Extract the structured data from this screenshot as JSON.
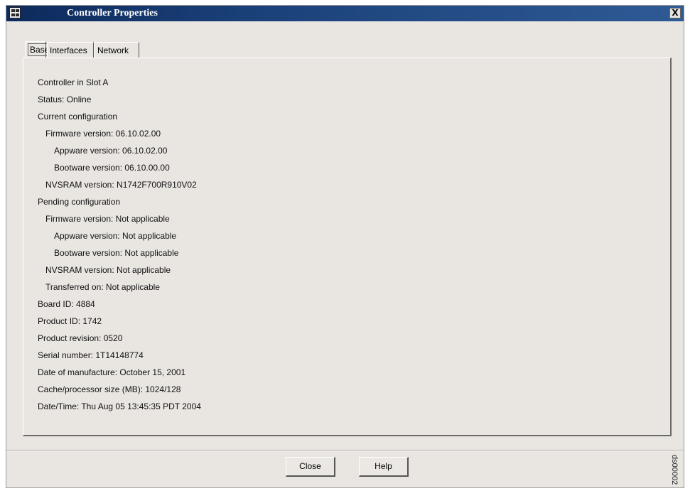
{
  "window": {
    "title": "Controller Properties",
    "close_glyph": "X"
  },
  "tabs": [
    {
      "label": "Base",
      "active": true
    },
    {
      "label": "Interfaces",
      "active": false
    },
    {
      "label": "Network",
      "active": false
    }
  ],
  "properties": [
    "Controller in Slot A",
    "Status: Online",
    "Current configuration",
    "Firmware version: 06.10.02.00",
    "Appware version: 06.10.02.00",
    "Bootware version: 06.10.00.00",
    "NVSRAM version: N1742F700R910V02",
    "Pending configuration",
    "Firmware version: Not applicable",
    "Appware version: Not applicable",
    "Bootware version: Not applicable",
    "NVSRAM version: Not applicable",
    "Transferred on: Not applicable",
    "Board ID: 4884",
    "Product ID: 1742",
    "Product revision: 0520",
    "Serial number: 1T14148774",
    "Date of manufacture: October 15, 2001",
    "Cache/processor size (MB): 1024/128",
    "Date/Time: Thu Aug 05 13:45:35 PDT 2004"
  ],
  "buttons": {
    "close_label": "Close",
    "help_label": "Help"
  },
  "watermark": "ds00002",
  "icons": {
    "app": "table-grid-icon",
    "close": "close-icon"
  },
  "colors": {
    "titlebar": "#0d2a5c",
    "window_bg": "#e9e6e2"
  }
}
